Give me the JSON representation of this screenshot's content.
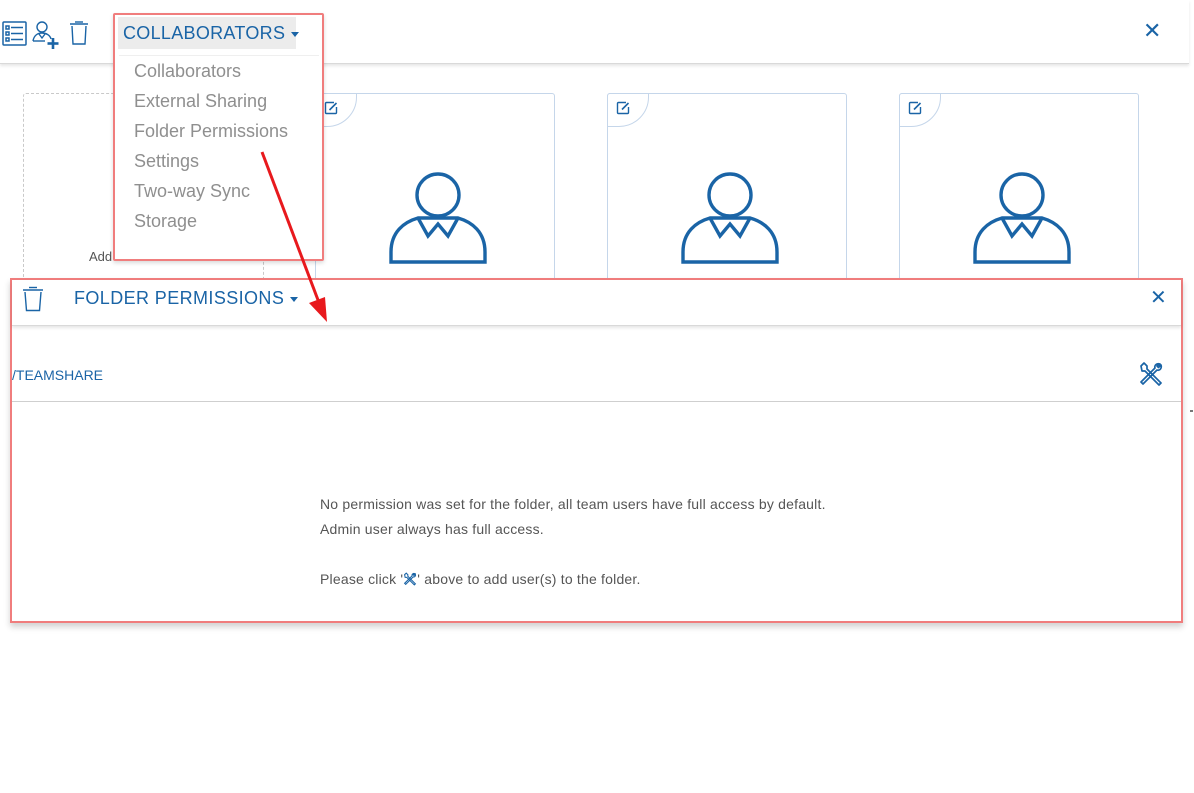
{
  "toolbar": {
    "icons": [
      "list-view-icon",
      "add-user-icon",
      "trash-icon"
    ],
    "close_icon": "close-icon"
  },
  "collaborators_dropdown": {
    "label": "COLLABORATORS",
    "items": [
      {
        "label": "Collaborators"
      },
      {
        "label": "External Sharing"
      },
      {
        "label": "Folder Permissions"
      },
      {
        "label": "Settings"
      },
      {
        "label": "Two-way Sync"
      },
      {
        "label": "Storage"
      }
    ]
  },
  "add_card": {
    "label": "Add Collaborator"
  },
  "user_cards": [
    {
      "edit_icon": "edit-icon",
      "avatar_icon": "user-avatar-icon"
    },
    {
      "edit_icon": "edit-icon",
      "avatar_icon": "user-avatar-icon"
    },
    {
      "edit_icon": "edit-icon",
      "avatar_icon": "user-avatar-icon"
    }
  ],
  "folder_permissions": {
    "title": "FOLDER PERMISSIONS",
    "path": "/TEAMSHARE",
    "tools_icon": "tools-icon",
    "message_line1": "No permission was set for the folder, all team users have full access by default.",
    "message_line2": "Admin user always has full access.",
    "message_line3_before": "Please click '",
    "message_line3_after": "' above to add user(s) to the folder."
  },
  "colors": {
    "accent": "#1a64a6",
    "highlight_border": "#f07d7d",
    "annotation_arrow": "#e8191d",
    "menu_text": "#8f8f8f"
  }
}
